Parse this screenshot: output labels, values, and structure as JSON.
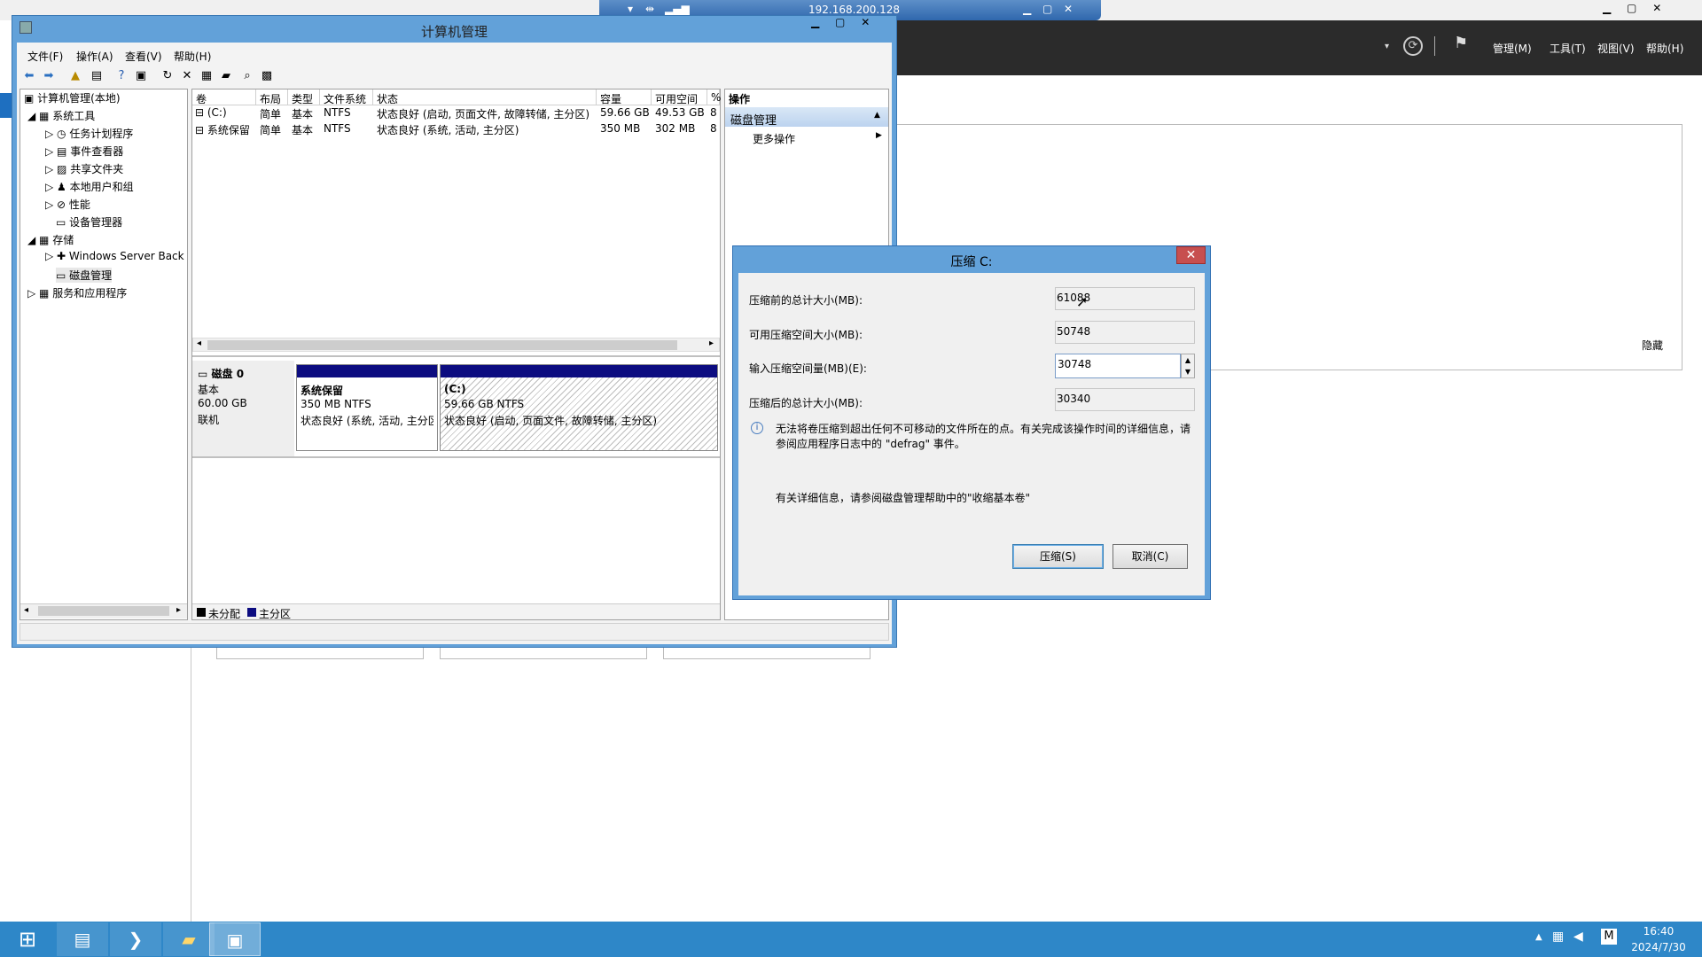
{
  "rdp": {
    "ip": "192.168.200.128"
  },
  "server_manager": {
    "menu": [
      "管理(M)",
      "工具(T)",
      "视图(V)",
      "帮助(H)"
    ],
    "hide": "隐藏"
  },
  "mmc": {
    "title": "计算机管理",
    "menu": [
      "文件(F)",
      "操作(A)",
      "查看(V)",
      "帮助(H)"
    ],
    "tree": [
      "计算机管理(本地)",
      "系统工具",
      "任务计划程序",
      "事件查看器",
      "共享文件夹",
      "本地用户和组",
      "性能",
      "设备管理器",
      "存储",
      "Windows Server Back",
      "磁盘管理",
      "服务和应用程序"
    ],
    "columns": [
      "卷",
      "布局",
      "类型",
      "文件系统",
      "状态",
      "容量",
      "可用空间",
      "%"
    ],
    "rows": [
      [
        "(C:)",
        "简单",
        "基本",
        "NTFS",
        "状态良好 (启动, 页面文件, 故障转储, 主分区)",
        "59.66 GB",
        "49.53 GB",
        "8"
      ],
      [
        "系统保留",
        "简单",
        "基本",
        "NTFS",
        "状态良好 (系统, 活动, 主分区)",
        "350 MB",
        "302 MB",
        "8"
      ]
    ],
    "disk": {
      "name": "磁盘 0",
      "type": "基本",
      "size": "60.00 GB",
      "status": "联机",
      "p1": {
        "name": "系统保留",
        "size": "350 MB NTFS",
        "status": "状态良好 (系统, 活动, 主分区"
      },
      "p2": {
        "name": "(C:)",
        "size": "59.66 GB NTFS",
        "status": "状态良好 (启动, 页面文件, 故障转储, 主分区)"
      }
    },
    "legend": [
      "未分配",
      "主分区"
    ],
    "actions": {
      "header": "操作",
      "section": "磁盘管理",
      "more": "更多操作"
    }
  },
  "dialog": {
    "title": "压缩 C:",
    "label_total": "压缩前的总计大小(MB):",
    "value_total": "61088",
    "label_avail": "可用压缩空间大小(MB):",
    "value_avail": "50748",
    "label_input": "输入压缩空间量(MB)(E):",
    "value_input": "30748",
    "label_after": "压缩后的总计大小(MB):",
    "value_after": "30340",
    "info": "无法将卷压缩到超出任何不可移动的文件所在的点。有关完成该操作时间的详细信息，请参阅应用程序日志中的 \"defrag\" 事件。",
    "help": "有关详细信息，请参阅磁盘管理帮助中的\"收缩基本卷\"",
    "ok": "压缩(S)",
    "cancel": "取消(C)"
  },
  "taskbar": {
    "time": "16:40",
    "date": "2024/7/30"
  }
}
